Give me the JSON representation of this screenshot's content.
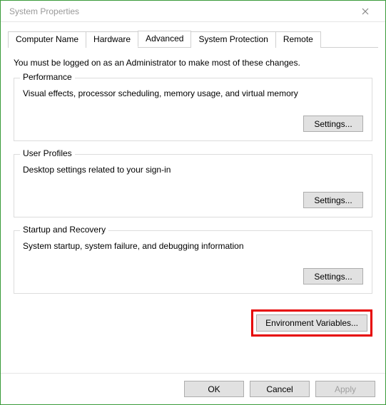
{
  "window": {
    "title": "System Properties"
  },
  "tabs": {
    "computer_name": "Computer Name",
    "hardware": "Hardware",
    "advanced": "Advanced",
    "system_protection": "System Protection",
    "remote": "Remote"
  },
  "admin_note": "You must be logged on as an Administrator to make most of these changes.",
  "performance": {
    "title": "Performance",
    "desc": "Visual effects, processor scheduling, memory usage, and virtual memory",
    "settings_label": "Settings..."
  },
  "user_profiles": {
    "title": "User Profiles",
    "desc": "Desktop settings related to your sign-in",
    "settings_label": "Settings..."
  },
  "startup_recovery": {
    "title": "Startup and Recovery",
    "desc": "System startup, system failure, and debugging information",
    "settings_label": "Settings..."
  },
  "env_button": "Environment Variables...",
  "footer": {
    "ok": "OK",
    "cancel": "Cancel",
    "apply": "Apply"
  }
}
